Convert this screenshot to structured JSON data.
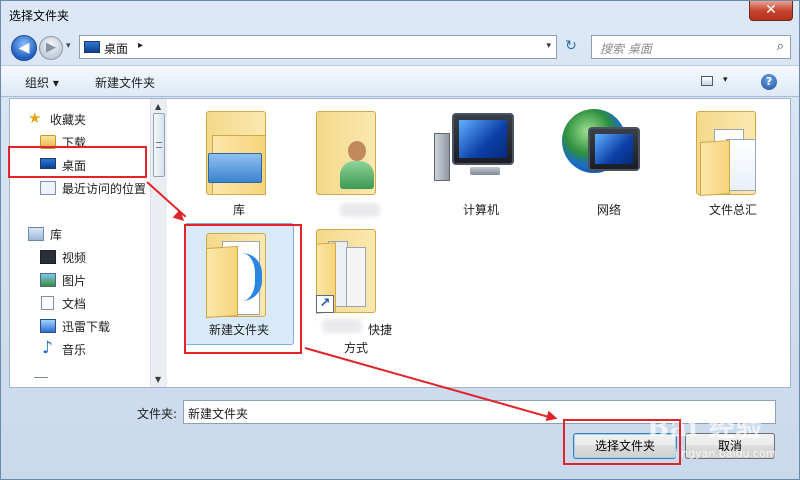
{
  "window": {
    "title": "选择文件夹",
    "close_label": "✕"
  },
  "navbar": {
    "back_glyph": "◀",
    "forward_glyph": "▶",
    "address": "桌面",
    "address_sep": "▸",
    "search_placeholder": "搜索 桌面",
    "refresh_glyph": "↻",
    "search_glyph": "⌕"
  },
  "toolbar": {
    "organize": "组织 ▾",
    "new_folder": "新建文件夹",
    "view_drop": "▾",
    "help": "?"
  },
  "sidebar": {
    "items": [
      {
        "label": "收藏夹",
        "icon": "star-icon"
      },
      {
        "label": "下载",
        "icon": "folder-icon"
      },
      {
        "label": "桌面",
        "icon": "desktop-icon"
      },
      {
        "label": "最近访问的位置",
        "icon": "recent-places-icon"
      },
      {
        "label": "库",
        "icon": "library-icon"
      },
      {
        "label": "视频",
        "icon": "video-icon"
      },
      {
        "label": "图片",
        "icon": "pictures-icon"
      },
      {
        "label": "文档",
        "icon": "documents-icon"
      },
      {
        "label": "迅雷下载",
        "icon": "download-icon"
      },
      {
        "label": "音乐",
        "icon": "music-icon"
      }
    ]
  },
  "files": [
    {
      "label": "库",
      "icon": "library-folder-icon"
    },
    {
      "label": "",
      "icon": "user-folder-icon"
    },
    {
      "label": "计算机",
      "icon": "computer-icon"
    },
    {
      "label": "网络",
      "icon": "network-icon"
    },
    {
      "label": "文件总汇",
      "icon": "folder-icon"
    },
    {
      "label": "新建文件夹",
      "icon": "folder-icon"
    },
    {
      "label": "快捷",
      "label2": "方式",
      "icon": "shortcut-folder-icon"
    }
  ],
  "footer": {
    "filename_label": "文件夹:",
    "filename_value": "新建文件夹",
    "select_button": "选择文件夹",
    "cancel_button": "取消"
  },
  "watermark": {
    "main": "Bai 经验",
    "sub": "jingyan.baidu.com"
  },
  "colors": {
    "annotation_red": "#e0242a",
    "selection_blue": "#d9ebfb"
  }
}
